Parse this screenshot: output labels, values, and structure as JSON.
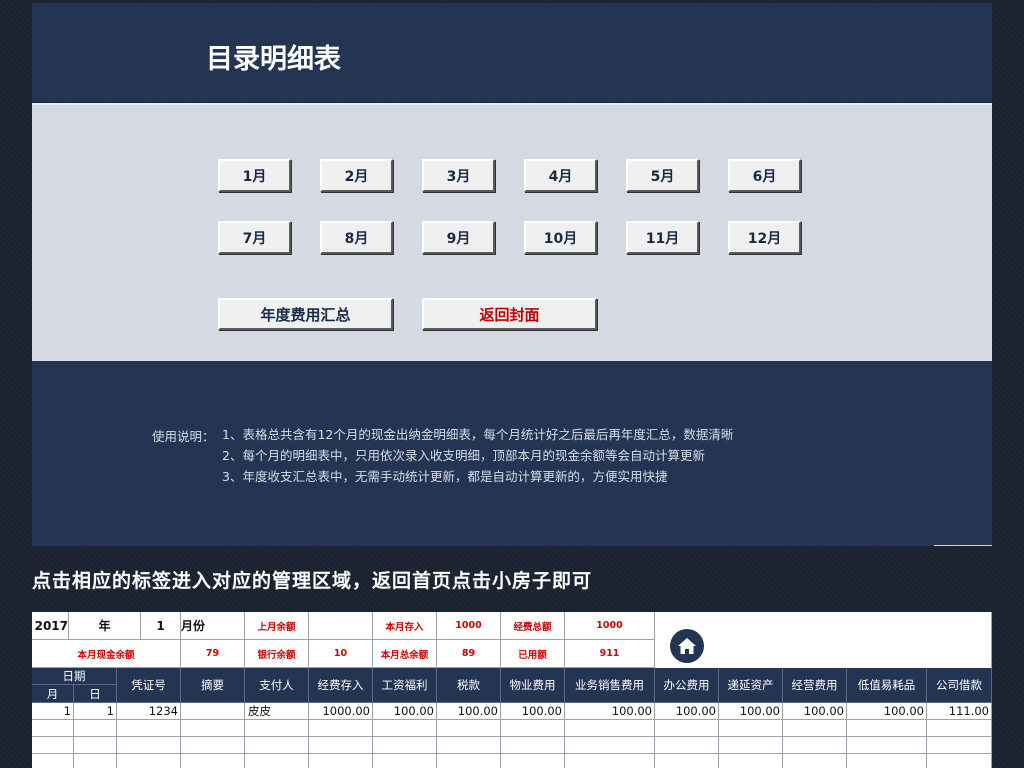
{
  "header": {
    "title": "目录明细表"
  },
  "months": [
    "1月",
    "2月",
    "3月",
    "4月",
    "5月",
    "6月",
    "7月",
    "8月",
    "9月",
    "10月",
    "11月",
    "12月"
  ],
  "actions": {
    "annual_summary": "年度费用汇总",
    "back_cover": "返回封面"
  },
  "instructions": {
    "label": "使用说明：",
    "lines": [
      "1、表格总共含有12个月的现金出纳金明细表，每个月统计好之后最后再年度汇总，数据清晰",
      "2、每个月的明细表中，只用依次录入收支明细，顶部本月的现金余额等会自动计算更新",
      "3、年度收支汇总表中，无需手动统计更新，都是自动计算更新的，方便实用快捷"
    ]
  },
  "caption": "点击相应的标签进入对应的管理区域，返回首页点击小房子即可",
  "sheet": {
    "year": "2017",
    "year_unit": "年",
    "month": "1",
    "month_unit": "月份",
    "summary1": [
      {
        "label": "上月余额",
        "value": ""
      },
      {
        "label": "本月存入",
        "value": "1000"
      },
      {
        "label": "经费总额",
        "value": "1000"
      }
    ],
    "cash_balance_label": "本月现金余额",
    "cash_balance_value": "79",
    "summary2": [
      {
        "label": "银行余额",
        "value": "10"
      },
      {
        "label": "本月总余额",
        "value": "89"
      },
      {
        "label": "已用额",
        "value": "911"
      }
    ],
    "headers": {
      "date": "日期",
      "month": "月",
      "day": "日",
      "voucher": "凭证号",
      "summary": "摘要",
      "payer": "支付人",
      "cols": [
        "经费存入",
        "工资福利",
        "税款",
        "物业费用",
        "业务销售费用",
        "办公费用",
        "递延资产",
        "经营费用",
        "低值易耗品",
        "公司借款"
      ]
    },
    "row1": {
      "month": "1",
      "day": "1",
      "voucher": "1234",
      "summary": "",
      "payer": "皮皮",
      "values": [
        "1000.00",
        "100.00",
        "100.00",
        "100.00",
        "100.00",
        "100.00",
        "100.00",
        "100.00",
        "100.00",
        "111.00"
      ]
    }
  },
  "colors": {
    "navy": "#233553",
    "panel": "#d4d9e2",
    "red": "#c00000"
  }
}
